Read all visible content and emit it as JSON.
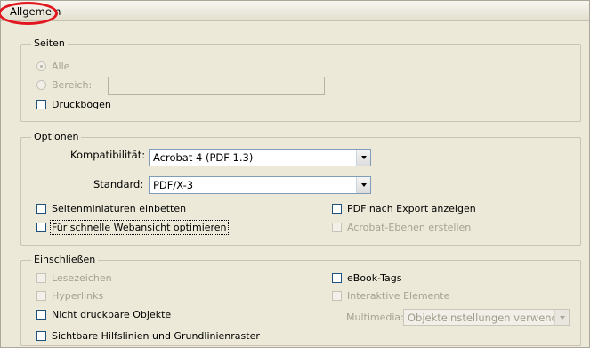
{
  "title": "Allgemein",
  "seiten": {
    "legend": "Seiten",
    "alle": "Alle",
    "bereich": "Bereich:",
    "druckboegen": "Druckbögen"
  },
  "optionen": {
    "legend": "Optionen",
    "kompatibilitaet_label": "Kompatibilität:",
    "kompatibilitaet_value": "Acrobat 4 (PDF 1.3)",
    "standard_label": "Standard:",
    "standard_value": "PDF/X-3",
    "seitenminiaturen": "Seitenminiaturen einbetten",
    "webansicht": "Für schnelle Webansicht optimieren",
    "pdf_export": "PDF nach Export anzeigen",
    "acrobat_ebenen": "Acrobat-Ebenen erstellen"
  },
  "einschliessen": {
    "legend": "Einschließen",
    "lesezeichen": "Lesezeichen",
    "hyperlinks": "Hyperlinks",
    "nicht_druckbar": "Nicht druckbare Objekte",
    "hilfslinien": "Sichtbare Hilfslinien und Grundlinienraster",
    "ebook_tags": "eBook-Tags",
    "interaktive": "Interaktive Elemente",
    "multimedia_label": "Multimedia:",
    "multimedia_value": "Objekteinstellungen verwenden"
  },
  "colors": {
    "highlight": "#e3161f",
    "background": "#ece9d8",
    "disabled_text": "#a6a292"
  }
}
